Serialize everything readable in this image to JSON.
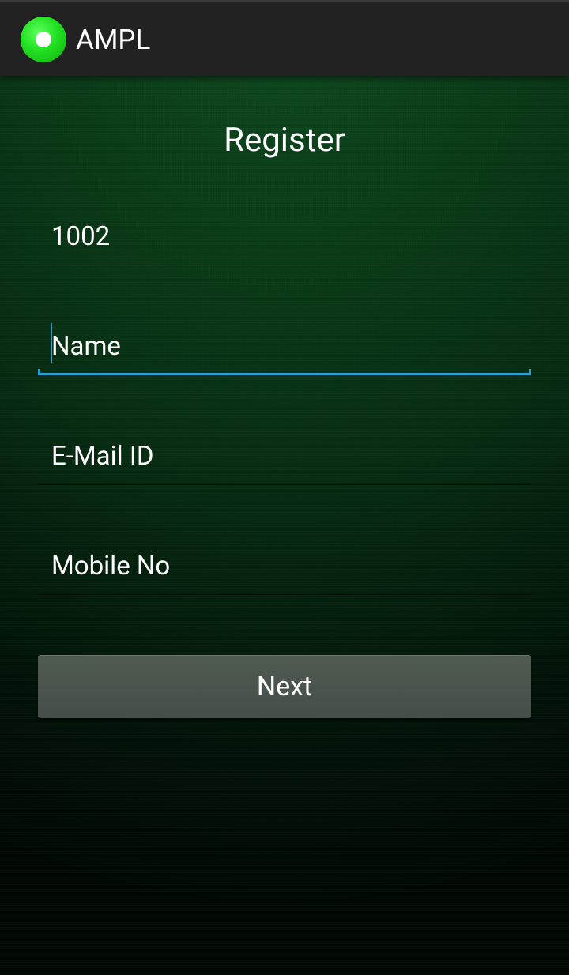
{
  "app": {
    "title": "AMPL",
    "logo_icon": "app-logo-icon",
    "logo_color": "#21e021"
  },
  "page": {
    "title": "Register"
  },
  "form": {
    "id_field": {
      "value": "1002",
      "placeholder": ""
    },
    "name_field": {
      "value": "",
      "placeholder": "Name",
      "focused": true
    },
    "email_field": {
      "value": "",
      "placeholder": "E-Mail ID"
    },
    "mobile_field": {
      "value": "",
      "placeholder": "Mobile No"
    },
    "next_label": "Next"
  },
  "colors": {
    "focus_accent": "#2a9fd0",
    "actionbar": "#222222",
    "button": "#4a544c"
  }
}
